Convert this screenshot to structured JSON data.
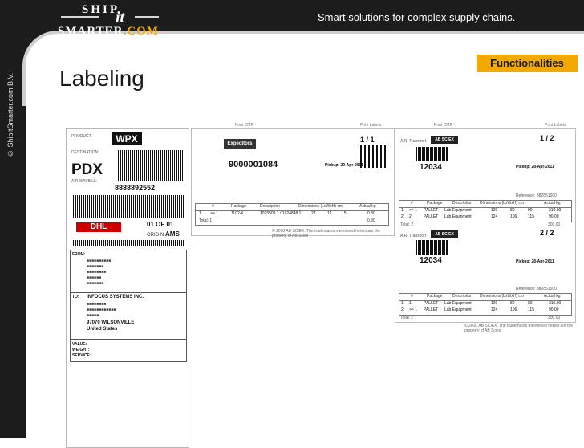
{
  "header": {
    "logo_ship": "SHIP",
    "logo_it": "it",
    "logo_smarter": "SMARTER",
    "logo_dotcom": ".COM",
    "tagline": "Smart solutions for complex supply chains."
  },
  "sidebar": {
    "copyright": "© ShipItSmarter.com B.V."
  },
  "badge": "Functionalities",
  "title": "Labeling",
  "label": {
    "product_label": "PRODUCT:",
    "product_code": "WPX",
    "destination_label": "DESTINATION:",
    "destination_code": "PDX",
    "awb_label": "AIR WAYBILL:",
    "awb_number": "8888892552",
    "carrier": "DHL",
    "page": "01 OF 01",
    "origin_label": "ORIGIN",
    "origin_code": "AMS",
    "from_label": "FROM:",
    "to_label": "TO:",
    "to_name": "INFOCUS SYSTEMS INC.",
    "to_city": "97070 WILSONVILLE",
    "to_country": "United States",
    "value_label": "VALUE:",
    "weight_label": "WEIGHT:",
    "service_label": "SERVICE:"
  },
  "sheet1": {
    "header_left": "Print CMR",
    "header_right": "Print Labels",
    "carrier_logo": "Expeditors",
    "cmr_number": "9000001084",
    "page_fraction": "1 / 1",
    "pickup_date": "Pickup: 29-Apr-2011",
    "columns": [
      "#",
      "Package",
      "Description",
      "Dimensions (LxWxH) cm",
      "Actual kg"
    ],
    "rows": [
      [
        "1",
        ">> 1",
        "1102-K",
        "1025509 1 / 1024848 1",
        "27",
        "11",
        "15",
        "0.30"
      ]
    ],
    "total_label": "Total: 1",
    "total_value": "0.30",
    "footer": "© 2010 AB SCIEX. The trademarks mentioned herein are the property of AB Sciex"
  },
  "sheet2": {
    "header_a": "Print CMR",
    "header_b": "Print Labels",
    "carrier": "A.R. Transport",
    "brand_logo": "AB SCIEX",
    "pages": [
      {
        "fraction": "1 / 2",
        "cmr_number": "12034",
        "pickup_date": "Pickup: 28-Apr-2011",
        "reference": "Reference: 882851000",
        "columns": [
          "#",
          "Package",
          "Description",
          "Dimensions (LxWxH) cm",
          "Actual kg"
        ],
        "rows": [
          [
            "1",
            ">> 1",
            "PALLET",
            "Lab Equipment",
            "120",
            "80",
            "90",
            "210.00"
          ],
          [
            "2",
            "2",
            "PALLET",
            "Lab Equipment",
            "124",
            "106",
            "115",
            "90.00"
          ]
        ],
        "total_label": "Total: 2",
        "total_value": "300.00"
      },
      {
        "fraction": "2 / 2",
        "cmr_number": "12034",
        "pickup_date": "Pickup: 28-Apr-2011",
        "reference": "Reference: 882851000",
        "columns": [
          "#",
          "Package",
          "Description",
          "Dimensions (LxWxH) cm",
          "Actual kg"
        ],
        "rows": [
          [
            "1",
            "1",
            "PALLET",
            "Lab Equipment",
            "120",
            "80",
            "80",
            "210.00"
          ],
          [
            "2",
            ">> 1",
            "PALLET",
            "Lab Equipment",
            "124",
            "106",
            "115",
            "90.00"
          ]
        ],
        "total_label": "Total: 2",
        "total_value": "300.00"
      }
    ],
    "footer": "© 2010 AB SCIEX. The trademarks mentioned herein are the property of AB Sciex"
  }
}
